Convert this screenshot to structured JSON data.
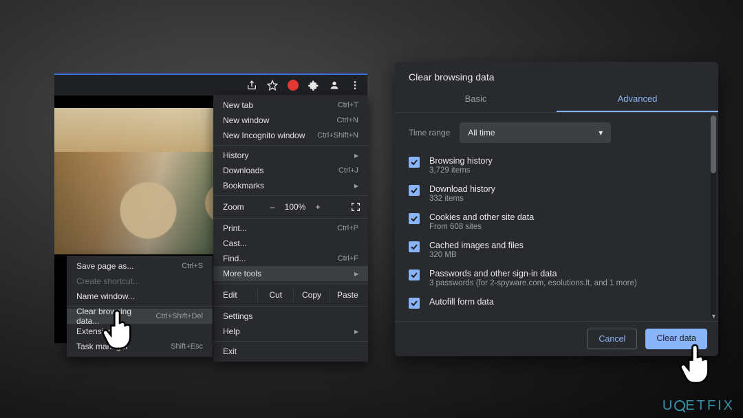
{
  "toolbar_icons": {
    "share": "share-icon",
    "star": "star-icon",
    "adblock": "red-circle-icon",
    "extensions": "puzzle-icon",
    "profile": "profile-icon",
    "menu": "kebab-icon"
  },
  "menu": {
    "new_tab": {
      "label": "New tab",
      "shortcut": "Ctrl+T"
    },
    "new_window": {
      "label": "New window",
      "shortcut": "Ctrl+N"
    },
    "new_incognito": {
      "label": "New Incognito window",
      "shortcut": "Ctrl+Shift+N"
    },
    "history": {
      "label": "History"
    },
    "downloads": {
      "label": "Downloads",
      "shortcut": "Ctrl+J"
    },
    "bookmarks": {
      "label": "Bookmarks"
    },
    "zoom": {
      "label": "Zoom",
      "minus": "–",
      "value": "100%",
      "plus": "+"
    },
    "print": {
      "label": "Print...",
      "shortcut": "Ctrl+P"
    },
    "cast": {
      "label": "Cast..."
    },
    "find": {
      "label": "Find...",
      "shortcut": "Ctrl+F"
    },
    "more_tools": {
      "label": "More tools"
    },
    "edit": {
      "label": "Edit",
      "cut": "Cut",
      "copy": "Copy",
      "paste": "Paste"
    },
    "settings": {
      "label": "Settings"
    },
    "help": {
      "label": "Help"
    },
    "exit": {
      "label": "Exit"
    }
  },
  "submenu": {
    "save_page": {
      "label": "Save page as...",
      "shortcut": "Ctrl+S"
    },
    "create_shortcut": {
      "label": "Create shortcut..."
    },
    "name_window": {
      "label": "Name window..."
    },
    "clear_browsing": {
      "label": "Clear browsing data...",
      "shortcut": "Ctrl+Shift+Del"
    },
    "extensions": {
      "label": "Extensions"
    },
    "task_manager": {
      "label": "Task manager",
      "shortcut": "Shift+Esc"
    }
  },
  "dialog": {
    "title": "Clear browsing data",
    "tabs": {
      "basic": "Basic",
      "advanced": "Advanced"
    },
    "time_range_label": "Time range",
    "time_range_value": "All time",
    "options": [
      {
        "title": "Browsing history",
        "sub": "3,729 items"
      },
      {
        "title": "Download history",
        "sub": "332 items"
      },
      {
        "title": "Cookies and other site data",
        "sub": "From 608 sites"
      },
      {
        "title": "Cached images and files",
        "sub": "320 MB"
      },
      {
        "title": "Passwords and other sign-in data",
        "sub": "3 passwords (for 2-spyware.com, esolutions.lt, and 1 more)"
      },
      {
        "title": "Autofill form data",
        "sub": ""
      }
    ],
    "cancel": "Cancel",
    "clear": "Clear data"
  },
  "watermark": "U   ETFIX"
}
